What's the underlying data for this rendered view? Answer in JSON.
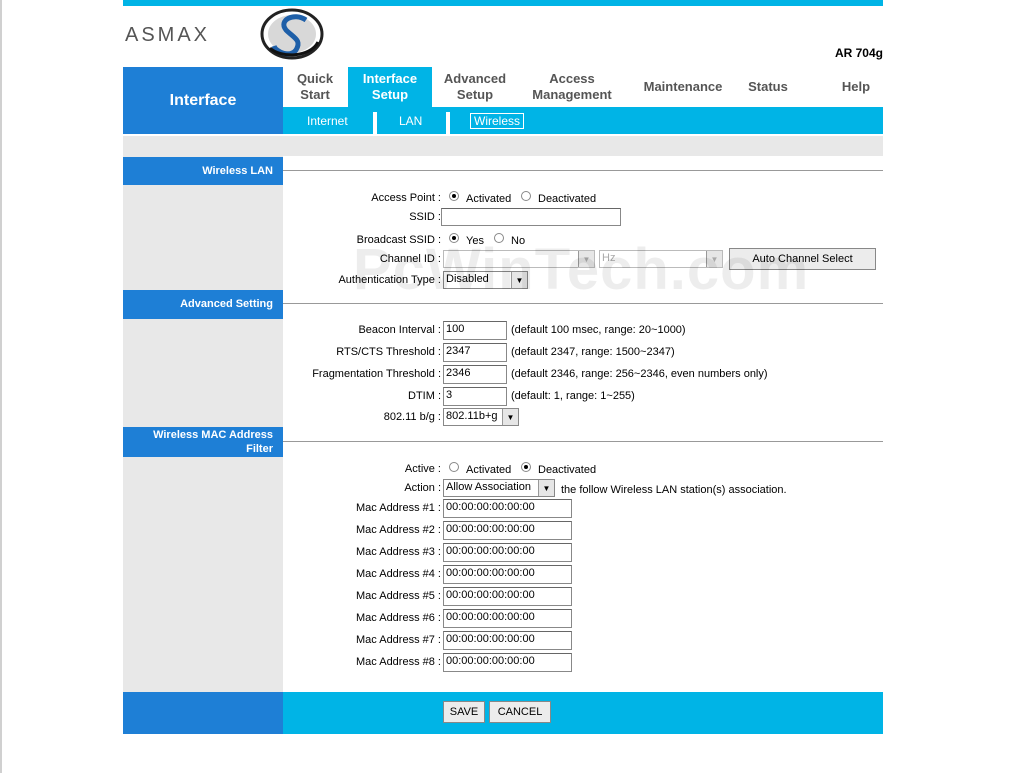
{
  "header": {
    "logo_text": "ASMAX",
    "model": "AR 704g"
  },
  "nav": {
    "section_title": "Interface",
    "tabs": [
      {
        "label": "Quick\nStart"
      },
      {
        "label": "Interface\nSetup"
      },
      {
        "label": "Advanced\nSetup"
      },
      {
        "label": "Access\nManagement"
      },
      {
        "label": "Maintenance"
      },
      {
        "label": "Status"
      },
      {
        "label": "Help"
      }
    ],
    "subtabs": [
      "Internet",
      "LAN",
      "Wireless"
    ]
  },
  "watermark": "PcWinTech.com",
  "wireless_lan": {
    "section_label": "Wireless LAN",
    "access_point_label": "Access Point :",
    "access_point_opts": [
      "Activated",
      "Deactivated"
    ],
    "access_point_value": "Activated",
    "ssid_label": "SSID :",
    "ssid_value": "",
    "broadcast_label": "Broadcast SSID :",
    "broadcast_opts": [
      "Yes",
      "No"
    ],
    "broadcast_value": "Yes",
    "channel_label": "Channel ID :",
    "channel_value": "",
    "channel_freq": "Hz",
    "auto_channel_btn": "Auto Channel Select",
    "auth_label": "Authentication Type :",
    "auth_value": "Disabled"
  },
  "advanced": {
    "section_label": "Advanced Setting",
    "beacon_label": "Beacon Interval :",
    "beacon_value": "100",
    "beacon_note": "(default 100 msec, range: 20~1000)",
    "rts_label": "RTS/CTS Threshold :",
    "rts_value": "2347",
    "rts_note": "(default 2347, range: 1500~2347)",
    "frag_label": "Fragmentation Threshold :",
    "frag_value": "2346",
    "frag_note": "(default 2346, range: 256~2346, even numbers only)",
    "dtim_label": "DTIM :",
    "dtim_value": "3",
    "dtim_note": "(default: 1, range: 1~255)",
    "mode_label": "802.11 b/g :",
    "mode_value": "802.11b+g"
  },
  "mac_filter": {
    "section_label_1": "Wireless MAC Address",
    "section_label_2": "Filter",
    "active_label": "Active :",
    "active_opts": [
      "Activated",
      "Deactivated"
    ],
    "active_value": "Deactivated",
    "action_label": "Action :",
    "action_value": "Allow Association",
    "action_note": "the follow Wireless LAN station(s) association.",
    "addresses": [
      {
        "label": "Mac Address #1 :",
        "value": "00:00:00:00:00:00"
      },
      {
        "label": "Mac Address #2 :",
        "value": "00:00:00:00:00:00"
      },
      {
        "label": "Mac Address #3 :",
        "value": "00:00:00:00:00:00"
      },
      {
        "label": "Mac Address #4 :",
        "value": "00:00:00:00:00:00"
      },
      {
        "label": "Mac Address #5 :",
        "value": "00:00:00:00:00:00"
      },
      {
        "label": "Mac Address #6 :",
        "value": "00:00:00:00:00:00"
      },
      {
        "label": "Mac Address #7 :",
        "value": "00:00:00:00:00:00"
      },
      {
        "label": "Mac Address #8 :",
        "value": "00:00:00:00:00:00"
      }
    ]
  },
  "footer": {
    "save_label": "SAVE",
    "cancel_label": "CANCEL"
  }
}
